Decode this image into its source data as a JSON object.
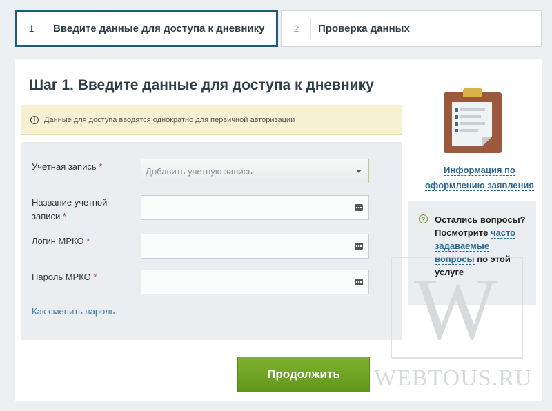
{
  "steps": [
    {
      "number": "1",
      "title": "Введите данные для доступа к дневнику",
      "active": true
    },
    {
      "number": "2",
      "title": "Проверка данных",
      "active": false
    }
  ],
  "page": {
    "title": "Шаг 1. Введите данные для доступа к дневнику"
  },
  "notice": {
    "icon": "info-icon",
    "text": "Данные для доступа вводятся однократно для первичной авторизации"
  },
  "form": {
    "account": {
      "label": "Учетная запись",
      "required_mark": "*",
      "selected": "Добавить учетную запись"
    },
    "account_name": {
      "label": "Название учетной записи",
      "required_mark": "*",
      "value": ""
    },
    "login": {
      "label": "Логин МРКО",
      "required_mark": "*",
      "value": ""
    },
    "password": {
      "label": "Пароль МРКО",
      "required_mark": "*",
      "value": ""
    },
    "change_password_link": "Как сменить пароль"
  },
  "submit_label": "Продолжить",
  "sidebar": {
    "clipboard_icon": "clipboard-icon",
    "info_link": "Информация по оформлению заявления",
    "faq": {
      "icon": "question-icon",
      "text_before": "Остались вопросы? Посмотрите",
      "link": "часто задаваемые вопросы",
      "text_after": "по этой услуге"
    }
  },
  "watermark": {
    "letter": "W",
    "text": "WEBTOUS.RU"
  },
  "colors": {
    "primary_button": "#6fa422",
    "active_step_border": "#1f5a7a",
    "link": "#2b6a93",
    "notice_bg": "#f7f1d2"
  }
}
